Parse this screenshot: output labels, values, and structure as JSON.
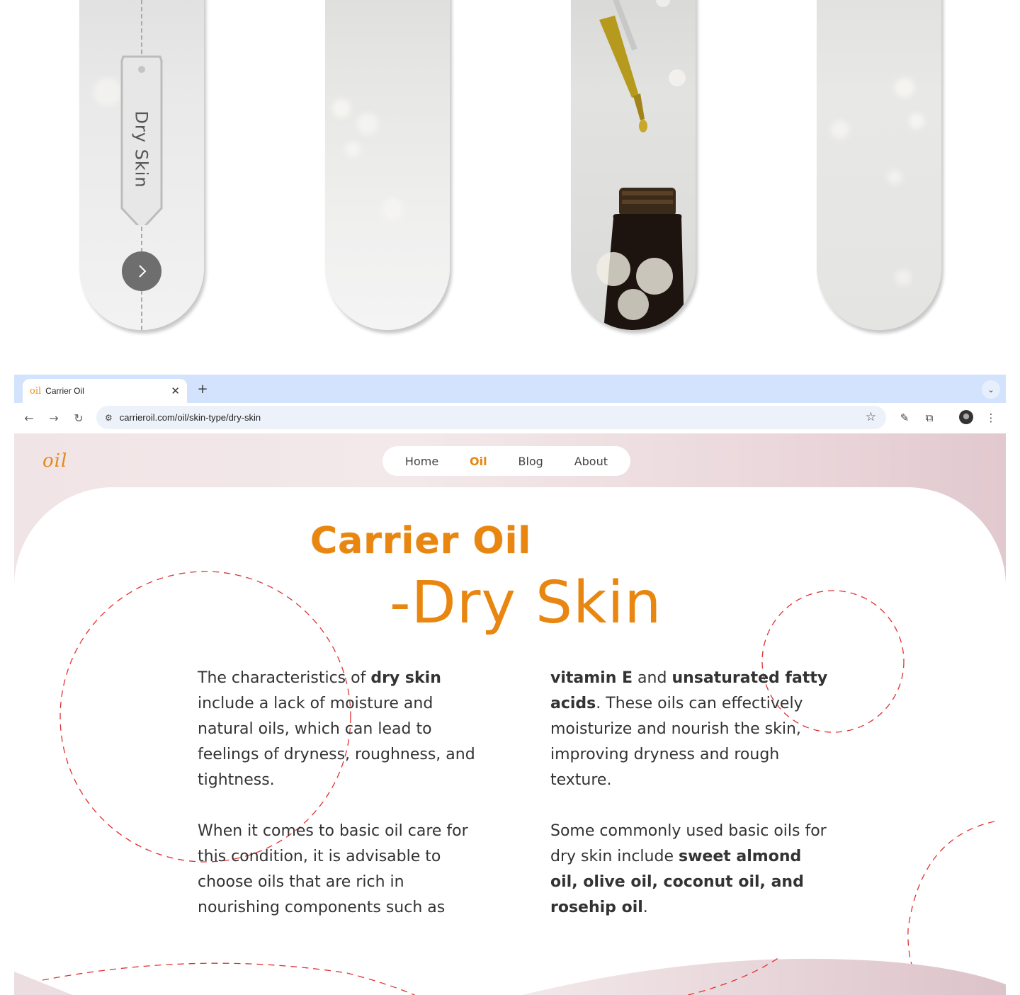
{
  "cards": [
    {
      "tag_label": "Dry Skin"
    },
    {},
    {},
    {}
  ],
  "browser": {
    "tab_title": "Carrier Oil",
    "tab_favicon": "oil",
    "url": "carrieroil.com/oil/skin-type/dry-skin"
  },
  "site": {
    "logo": "oil",
    "nav": [
      {
        "label": "Home",
        "active": false
      },
      {
        "label": "Oil",
        "active": true
      },
      {
        "label": "Blog",
        "active": false
      },
      {
        "label": "About",
        "active": false
      }
    ],
    "title_line1": "Carrier Oil",
    "title_line2": "-Dry Skin",
    "left_p1_a": "The characteristics of ",
    "left_p1_b": "dry skin",
    "left_p1_c": " include a lack of moisture and natural oils, which can lead to feelings of dryness, roughness, and tightness.",
    "left_p2": "When it comes to basic oil care for this condition, it is advisable to choose oils that are rich in nourishing components such as",
    "right_p1_a": "vitamin E",
    "right_p1_b": " and ",
    "right_p1_c": "unsaturated fatty acids",
    "right_p1_d": ". These oils can effectively moisturize and nourish the skin, improving dryness and rough texture.",
    "right_p2_a": "Some commonly used basic oils for dry skin include ",
    "right_p2_b": "sweet almond oil, olive oil, coconut oil, and rosehip oil",
    "right_p2_c": "."
  },
  "colors": {
    "accent": "#e8860f",
    "deco_dash": "#e0302f",
    "header_bg": "#f1e4e6"
  },
  "icons": [
    "chevron-right-icon",
    "close-icon",
    "plus-icon",
    "chevron-down-icon",
    "back-arrow-icon",
    "forward-arrow-icon",
    "reload-icon",
    "site-settings-icon",
    "star-icon",
    "eyedropper-icon",
    "extensions-icon",
    "profile-avatar",
    "more-menu-icon"
  ]
}
